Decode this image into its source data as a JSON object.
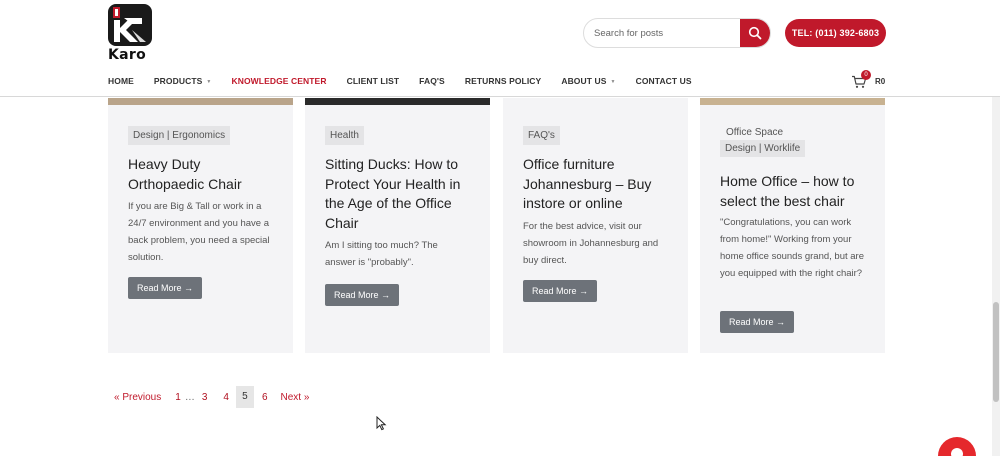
{
  "brand": {
    "logo_text": "Karo"
  },
  "search": {
    "placeholder": "Search for posts"
  },
  "header": {
    "tel_label": "TEL: (011) 392-6803"
  },
  "nav": {
    "items": [
      {
        "label": "HOME"
      },
      {
        "label": "PRODUCTS"
      },
      {
        "label": "KNOWLEDGE CENTER"
      },
      {
        "label": "CLIENT LIST"
      },
      {
        "label": "FAQ'S"
      },
      {
        "label": "RETURNS POLICY"
      },
      {
        "label": "ABOUT US"
      },
      {
        "label": "CONTACT US"
      }
    ]
  },
  "cart": {
    "count": "0",
    "total": "R0"
  },
  "posts": [
    {
      "category": "Design | Ergonomics",
      "title": "Heavy Duty Orthopaedic Chair",
      "excerpt": "If you are Big & Tall or work in a 24/7 environment and you have a back problem, you need a special solution.",
      "button": "Read More →"
    },
    {
      "category": "Health",
      "title": "Sitting Ducks: How to Protect Your Health in the Age of the Office Chair",
      "excerpt": "Am I sitting too much? The answer is \"probably\".",
      "button": "Read More →"
    },
    {
      "category": "FAQ's",
      "title": "Office furniture Johannesburg – Buy instore or online",
      "excerpt": "For the best advice, visit our showroom in Johannesburg and buy direct.",
      "button": "Read More →"
    },
    {
      "category_line1": "Office Space",
      "category_line2": "Design | Worklife",
      "title": "Home Office – how to select the best chair",
      "excerpt": "\"Congratulations, you can work from home!\" Working from your home office sounds grand, but are you equipped with the right chair?",
      "button": "Read More →"
    }
  ],
  "pagination": {
    "previous": "« Previous",
    "pages": [
      "1",
      "…",
      "3",
      "4",
      "5",
      "6"
    ],
    "current": "5",
    "next": "Next »"
  },
  "colors": {
    "accent": "#c0192b",
    "card_bg": "#f4f4f6",
    "button_gray": "#6d7279"
  }
}
